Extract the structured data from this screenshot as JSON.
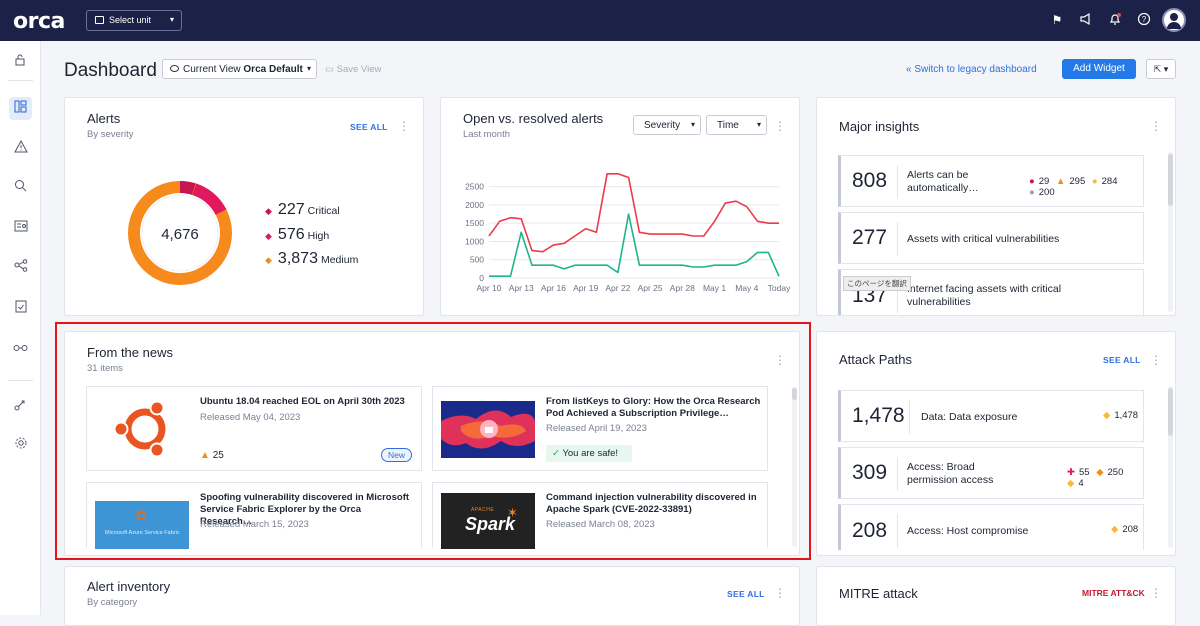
{
  "topbar": {
    "logo": "orca",
    "unit_select": "Select unit",
    "icons": [
      "flag-icon",
      "megaphone-icon",
      "bell-icon",
      "help-icon",
      "user-avatar"
    ]
  },
  "sidebar": {
    "items": [
      "unlock-icon",
      "dashboard-icon",
      "alert-icon",
      "search-icon",
      "inventory-icon",
      "graph-icon",
      "compliance-icon",
      "integrations-icon",
      "automation-icon",
      "settings-icon"
    ]
  },
  "header": {
    "title": "Dashboard",
    "current_view_label": "Current View",
    "current_view_value": "Orca Default",
    "save_view": "Save View",
    "legacy_link": "Switch to legacy dashboard",
    "add_widget": "Add Widget"
  },
  "alerts": {
    "title": "Alerts",
    "subtitle": "By severity",
    "see_all": "SEE ALL",
    "total": "4,676",
    "items": [
      {
        "count": "227",
        "label": "Critical",
        "color": "#c7154f"
      },
      {
        "count": "576",
        "label": "High",
        "color": "#e0195e"
      },
      {
        "count": "3,873",
        "label": "Medium",
        "color": "#f78a1d"
      }
    ]
  },
  "open_resolved": {
    "title": "Open vs. resolved alerts",
    "subtitle": "Last month",
    "severity_select": "Severity",
    "time_select": "Time"
  },
  "chart_data": {
    "type": "line",
    "title": "Open vs. resolved alerts",
    "x": [
      "Apr 10",
      "Apr 11",
      "Apr 12",
      "Apr 13",
      "Apr 14",
      "Apr 15",
      "Apr 16",
      "Apr 17",
      "Apr 18",
      "Apr 19",
      "Apr 20",
      "Apr 21",
      "Apr 22",
      "Apr 23",
      "Apr 24",
      "Apr 25",
      "Apr 26",
      "Apr 27",
      "Apr 28",
      "Apr 29",
      "Apr 30",
      "May 1",
      "May 2",
      "May 3",
      "May 4",
      "May 5",
      "May 6",
      "Today"
    ],
    "x_tick_labels": [
      "Apr 10",
      "Apr 13",
      "Apr 16",
      "Apr 19",
      "Apr 22",
      "Apr 25",
      "Apr 28",
      "May 1",
      "May 4",
      "Today"
    ],
    "series": [
      {
        "color": "#ec3b4a",
        "values": [
          1150,
          1550,
          1650,
          1620,
          750,
          720,
          900,
          950,
          1150,
          1350,
          1250,
          2850,
          2850,
          2750,
          1250,
          1200,
          1200,
          1200,
          1200,
          1150,
          1150,
          1550,
          2050,
          2100,
          1950,
          1550,
          1500,
          1500
        ]
      },
      {
        "color": "#1fb48c",
        "values": [
          50,
          50,
          50,
          1250,
          350,
          350,
          350,
          250,
          350,
          350,
          350,
          350,
          150,
          1750,
          350,
          350,
          350,
          350,
          350,
          300,
          300,
          350,
          350,
          350,
          450,
          700,
          700,
          50
        ]
      }
    ],
    "ylim": [
      0,
      2900
    ],
    "yticks": [
      0,
      500,
      1000,
      1500,
      2000,
      2500
    ],
    "grid": true
  },
  "insights": {
    "title": "Major insights",
    "items": [
      {
        "count": "808",
        "label": "Alerts can be automatically…",
        "badges": [
          {
            "v": "29",
            "c": "#c7154f"
          },
          {
            "v": "295",
            "c": "#f78a1d"
          },
          {
            "v": "284",
            "c": "#f6b93b"
          },
          {
            "v": "200",
            "c": "#9aa0b0"
          }
        ]
      },
      {
        "count": "277",
        "label": "Assets with critical vulnerabilities",
        "badges": []
      },
      {
        "count": "137",
        "label": "Internet facing assets with critical vulnerabilities",
        "badges": [],
        "tooltip": "このページを翻訳"
      }
    ]
  },
  "news": {
    "title": "From the news",
    "subtitle": "31 items",
    "items": [
      {
        "title": "Ubuntu 18.04 reached EOL on April 30th 2023",
        "date": "Released May 04, 2023",
        "alert_count": "25",
        "badge": "New"
      },
      {
        "title": "From listKeys to Glory: How the Orca Research Pod Achieved a Subscription Privilege…",
        "date": "Released April 19, 2023",
        "safe": "You are safe!"
      },
      {
        "title": "Spoofing vulnerability discovered in Microsoft Service Fabric Explorer by the Orca Research…",
        "date": "Released March 15, 2023",
        "image_caption": "Microsoft Azure Service Fabric"
      },
      {
        "title": "Command injection vulnerability discovered in Apache Spark (CVE-2022-33891)",
        "date": "Released March 08, 2023",
        "image_caption_small": "APACHE",
        "image_caption": "Spark"
      }
    ]
  },
  "attack_paths": {
    "title": "Attack Paths",
    "see_all": "SEE ALL",
    "items": [
      {
        "count": "1,478",
        "label": "Data: Data exposure",
        "badges": [
          {
            "v": "1,478",
            "c": "#f6b93b"
          }
        ]
      },
      {
        "count": "309",
        "label": "Access: Broad permission access",
        "badges": [
          {
            "v": "55",
            "c": "#e0195e"
          },
          {
            "v": "250",
            "c": "#f78a1d"
          },
          {
            "v": "4",
            "c": "#f6b93b"
          }
        ]
      },
      {
        "count": "208",
        "label": "Access: Host compromise",
        "badges": [
          {
            "v": "208",
            "c": "#f6b93b"
          }
        ]
      }
    ]
  },
  "inventory": {
    "title": "Alert inventory",
    "subtitle": "By category",
    "see_all": "SEE ALL"
  },
  "mitre": {
    "title": "MITRE attack",
    "logo": "MITRE ATT&CK"
  }
}
